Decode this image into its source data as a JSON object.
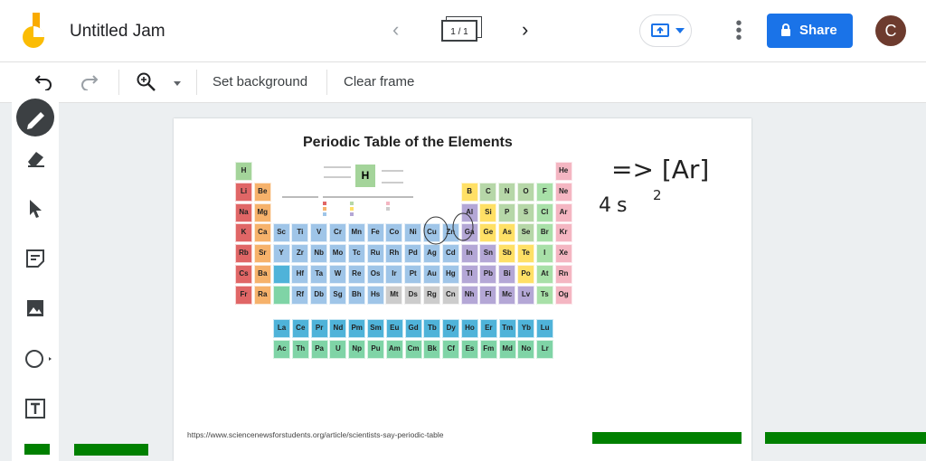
{
  "header": {
    "title": "Untitled Jam",
    "frame_indicator": "1 / 1",
    "share_label": "Share",
    "avatar_initial": "C",
    "icons": {
      "logo": "jamboard-logo",
      "prev": "chevron-left-icon",
      "next": "chevron-right-icon",
      "present": "cast-icon",
      "more": "more-vert-icon",
      "lock": "lock-icon"
    }
  },
  "toolbar": {
    "set_background": "Set background",
    "clear_frame": "Clear frame",
    "icons": [
      "undo-icon",
      "redo-icon",
      "zoom-in-icon",
      "dropdown-icon"
    ]
  },
  "sidebar": {
    "tools": [
      "pen-icon",
      "eraser-icon",
      "select-icon",
      "sticky-note-icon",
      "image-icon",
      "circle-icon",
      "text-box-icon"
    ]
  },
  "canvas": {
    "image_title": "Periodic Table of the Elements",
    "source_url": "https://www.sciencenewsforstudents.org/article/scientists-say-periodic-table",
    "handwriting": {
      "line1": "=> [Ar]",
      "line2": "4s",
      "superscript": "2"
    },
    "colors": {
      "alkali": "#e06666",
      "alkaline": "#f6b26b",
      "transition": "#9fc5e8",
      "post_transition": "#b4a7d6",
      "metalloid": "#ffe066",
      "nonmetal": "#b6d7a8",
      "halogen": "#a8e0a8",
      "noble": "#f4b6c2",
      "lanthanide": "#4fb3d9",
      "actinide": "#7fd4a6",
      "unknown": "#cccccc",
      "hydrogen": "#a4d49a"
    },
    "rows": [
      [
        "H",
        "",
        "",
        "",
        "",
        "",
        "",
        "",
        "",
        "",
        "",
        "",
        "",
        "",
        "",
        "",
        "",
        "He"
      ],
      [
        "Li",
        "Be",
        "",
        "",
        "",
        "",
        "",
        "",
        "",
        "",
        "",
        "",
        "B",
        "C",
        "N",
        "O",
        "F",
        "Ne"
      ],
      [
        "Na",
        "Mg",
        "",
        "",
        "",
        "",
        "",
        "",
        "",
        "",
        "",
        "",
        "Al",
        "Si",
        "P",
        "S",
        "Cl",
        "Ar"
      ],
      [
        "K",
        "Ca",
        "Sc",
        "Ti",
        "V",
        "Cr",
        "Mn",
        "Fe",
        "Co",
        "Ni",
        "Cu",
        "Zn",
        "Ga",
        "Ge",
        "As",
        "Se",
        "Br",
        "Kr"
      ],
      [
        "Rb",
        "Sr",
        "Y",
        "Zr",
        "Nb",
        "Mo",
        "Tc",
        "Ru",
        "Rh",
        "Pd",
        "Ag",
        "Cd",
        "In",
        "Sn",
        "Sb",
        "Te",
        "I",
        "Xe"
      ],
      [
        "Cs",
        "Ba",
        "",
        "Hf",
        "Ta",
        "W",
        "Re",
        "Os",
        "Ir",
        "Pt",
        "Au",
        "Hg",
        "Tl",
        "Pb",
        "Bi",
        "Po",
        "At",
        "Rn"
      ],
      [
        "Fr",
        "Ra",
        "",
        "Rf",
        "Db",
        "Sg",
        "Bh",
        "Hs",
        "Mt",
        "Ds",
        "Rg",
        "Cn",
        "Nh",
        "Fl",
        "Mc",
        "Lv",
        "Ts",
        "Og"
      ]
    ],
    "lanthanides": [
      "La",
      "Ce",
      "Pr",
      "Nd",
      "Pm",
      "Sm",
      "Eu",
      "Gd",
      "Tb",
      "Dy",
      "Ho",
      "Er",
      "Tm",
      "Yb",
      "Lu"
    ],
    "actinides": [
      "Ac",
      "Th",
      "Pa",
      "U",
      "Np",
      "Pu",
      "Am",
      "Cm",
      "Bk",
      "Cf",
      "Es",
      "Fm",
      "Md",
      "No",
      "Lr"
    ],
    "key_symbol": "H"
  }
}
